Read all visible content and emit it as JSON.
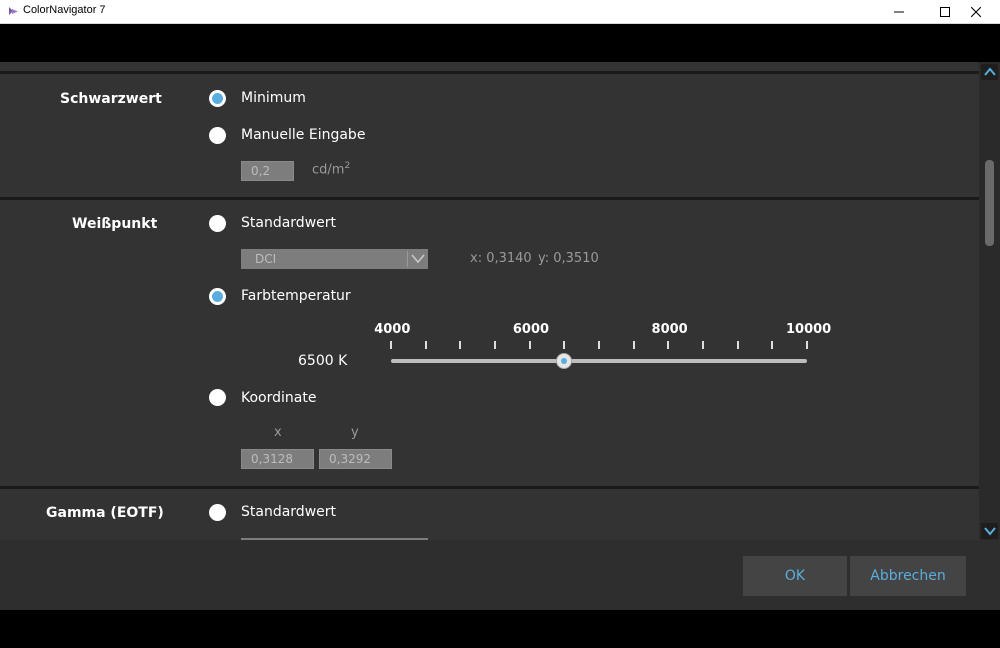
{
  "window": {
    "title": "ColorNavigator 7"
  },
  "schwarzwert": {
    "label": "Schwarzwert",
    "option_minimum": "Minimum",
    "option_manual": "Manuelle Eingabe",
    "manual_value": "0,2",
    "unit_base": "cd/m",
    "unit_sup": "2"
  },
  "weisspunkt": {
    "label": "Weißpunkt",
    "option_standard": "Standardwert",
    "standard_dropdown_value": "DCI",
    "coord_x_text": "x: 0,3140",
    "coord_y_text": "y: 0,3510",
    "option_farbtemperatur": "Farbtemperatur",
    "temperature_value_text": "6500 K",
    "slider": {
      "min": 4000,
      "max": 10000,
      "value": 6500,
      "tick_labels": [
        "4000",
        "6000",
        "8000",
        "10000"
      ]
    },
    "option_koordinate": "Koordinate",
    "x_label": "x",
    "y_label": "y",
    "x_value": "0,3128",
    "y_value": "0,3292"
  },
  "gamma": {
    "label": "Gamma (EOTF)",
    "option_standard": "Standardwert"
  },
  "buttons": {
    "ok": "OK",
    "cancel": "Abbrechen"
  },
  "colors": {
    "accent": "#5aaedf",
    "background": "#333333",
    "separator": "#1a1a1a"
  }
}
